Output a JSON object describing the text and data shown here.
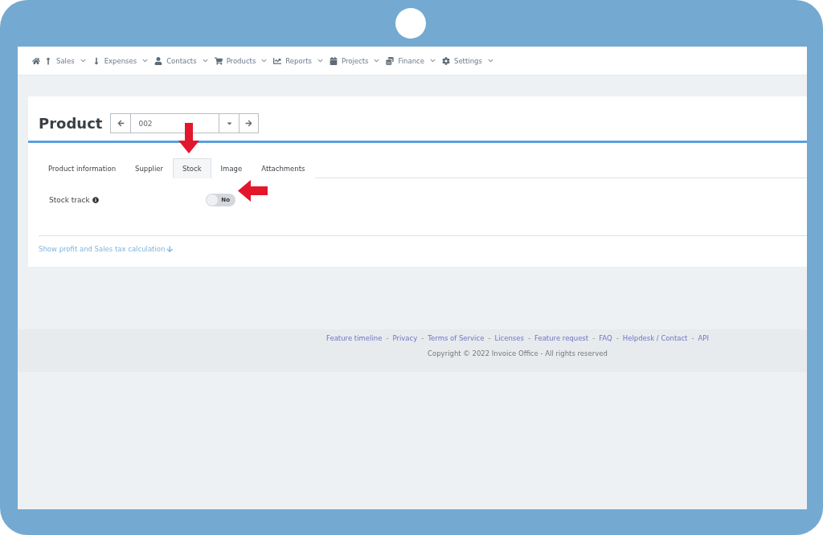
{
  "nav": [
    {
      "label": "Sales"
    },
    {
      "label": "Expenses"
    },
    {
      "label": "Contacts"
    },
    {
      "label": "Products"
    },
    {
      "label": "Reports"
    },
    {
      "label": "Projects"
    },
    {
      "label": "Finance"
    },
    {
      "label": "Settings"
    }
  ],
  "page": {
    "title": "Product",
    "record": "002"
  },
  "tabs": [
    {
      "label": "Product information",
      "selected": false
    },
    {
      "label": "Supplier",
      "selected": false
    },
    {
      "label": "Stock",
      "selected": true
    },
    {
      "label": "Image",
      "selected": false
    },
    {
      "label": "Attachments",
      "selected": false
    }
  ],
  "stock_track": {
    "label": "Stock track",
    "on": false,
    "value": "No"
  },
  "profit_link": "Show profit and Sales tax calculation",
  "footer": {
    "links": [
      "Feature timeline",
      "Privacy",
      "Terms of Service",
      "Licenses",
      "Feature request",
      "FAQ",
      "Helpdesk / Contact",
      "API"
    ],
    "separator": "-",
    "copyright": "Copyright © 2022 Invoice Office - All rights reserved"
  }
}
